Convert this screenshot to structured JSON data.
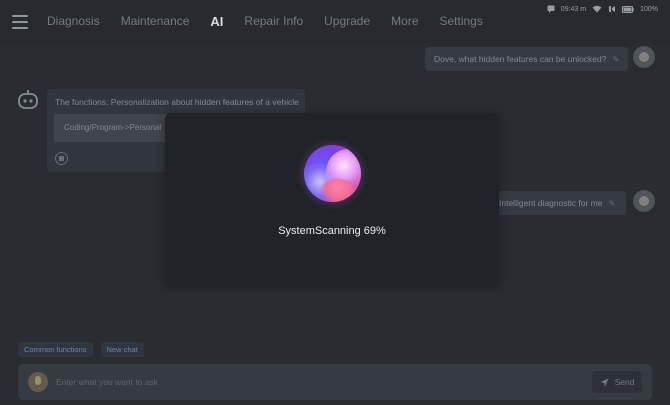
{
  "status_bar": {
    "time": "09:43 m",
    "battery": "100%"
  },
  "tabs": [
    {
      "label": "Diagnosis",
      "active": false
    },
    {
      "label": "Maintenance",
      "active": false
    },
    {
      "label": "AI",
      "active": true
    },
    {
      "label": "Repair Info",
      "active": false
    },
    {
      "label": "Upgrade",
      "active": false
    },
    {
      "label": "More",
      "active": false
    },
    {
      "label": "Settings",
      "active": false
    }
  ],
  "chat": {
    "user_message_1": "Dove, what hidden features can be unlocked?",
    "bot_message": "The functions: Personalization about hidden features of a vehicle",
    "bot_code": "Coding/Program->Personal",
    "user_message_2": "Intelligent diagnostic for me"
  },
  "chips": [
    "Common functions",
    "New chat"
  ],
  "input": {
    "placeholder": "Enter what you want to ask",
    "send_label": "Send"
  },
  "modal": {
    "status_text": "SystemScanning 69%",
    "progress_percent": 69
  },
  "colors": {
    "background": "#2c3036",
    "modal": "#202327",
    "accent": "#6f8fb5"
  }
}
